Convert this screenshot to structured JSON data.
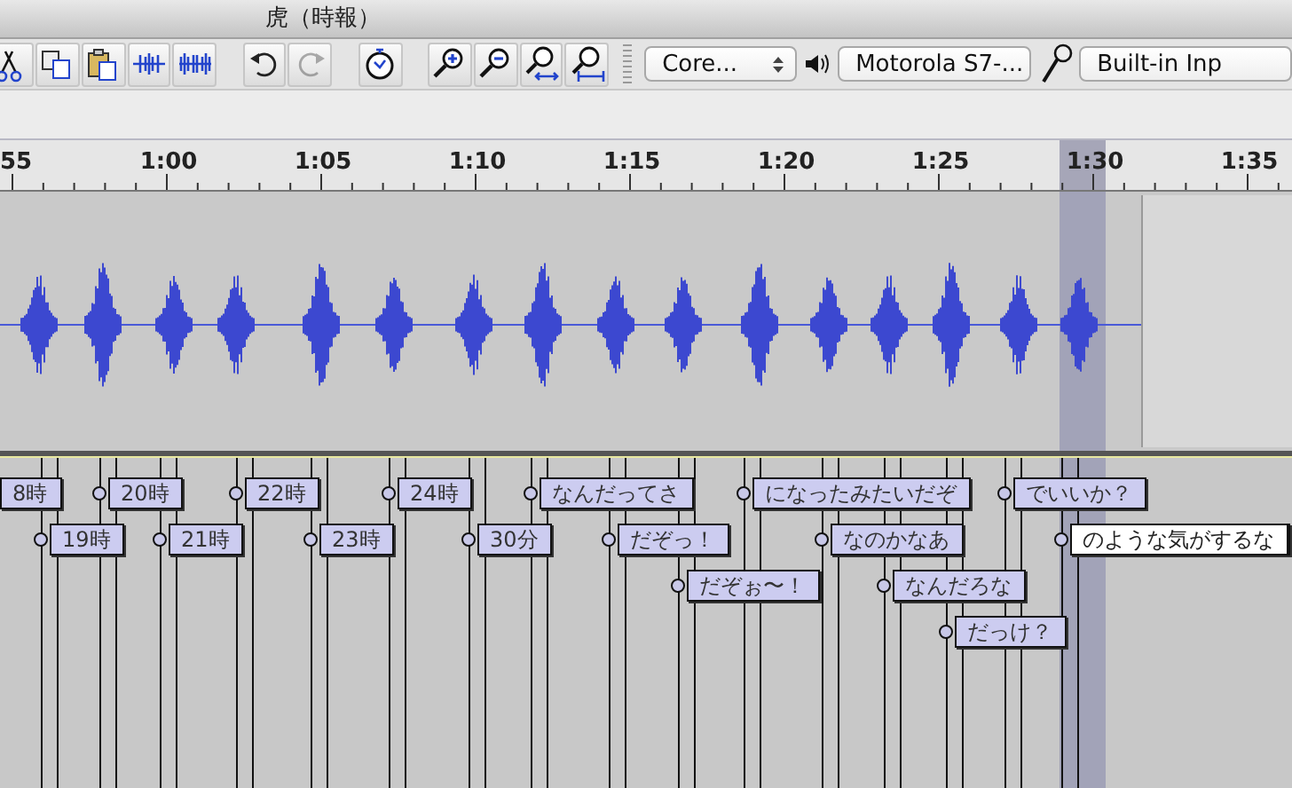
{
  "window": {
    "title": "虎（時報）"
  },
  "toolbar": {
    "tools": [
      {
        "kind": "cut",
        "disabled": false
      },
      {
        "kind": "copy",
        "disabled": false
      },
      {
        "kind": "paste",
        "disabled": false
      },
      {
        "kind": "trim",
        "disabled": false
      },
      {
        "kind": "silence",
        "disabled": false
      },
      {
        "kind": "undo",
        "disabled": false
      },
      {
        "kind": "redo",
        "disabled": true
      },
      {
        "kind": "timer",
        "disabled": false
      },
      {
        "kind": "zoom-in",
        "disabled": false
      },
      {
        "kind": "zoom-out",
        "disabled": false
      },
      {
        "kind": "fit-selection",
        "disabled": false
      },
      {
        "kind": "fit-project",
        "disabled": false
      }
    ],
    "devices": [
      {
        "kind": "host",
        "value": "Core..."
      },
      {
        "kind": "output",
        "value": "Motorola S7-..."
      },
      {
        "kind": "input",
        "value": "Built-in Inp"
      }
    ]
  },
  "ruler": {
    "ticks": [
      "55",
      "1:00",
      "1:05",
      "1:10",
      "1:15",
      "1:20",
      "1:25",
      "1:30",
      "1:35"
    ]
  },
  "label_track": {
    "labels": [
      {
        "text": "8時",
        "selected": false
      },
      {
        "text": "19時",
        "selected": false
      },
      {
        "text": "20時",
        "selected": false
      },
      {
        "text": "21時",
        "selected": false
      },
      {
        "text": "22時",
        "selected": false
      },
      {
        "text": "23時",
        "selected": false
      },
      {
        "text": "24時",
        "selected": false
      },
      {
        "text": "30分",
        "selected": false
      },
      {
        "text": "なんだってさ",
        "selected": false
      },
      {
        "text": "だぞっ！",
        "selected": false
      },
      {
        "text": "だぞぉ〜！",
        "selected": false
      },
      {
        "text": "になったみたいだぞ",
        "selected": false
      },
      {
        "text": "なのかなあ",
        "selected": false
      },
      {
        "text": "なんだろな",
        "selected": false
      },
      {
        "text": "だっけ？",
        "selected": false
      },
      {
        "text": "でいいか？",
        "selected": false
      },
      {
        "text": "のような気がするな",
        "selected": true
      }
    ]
  }
}
